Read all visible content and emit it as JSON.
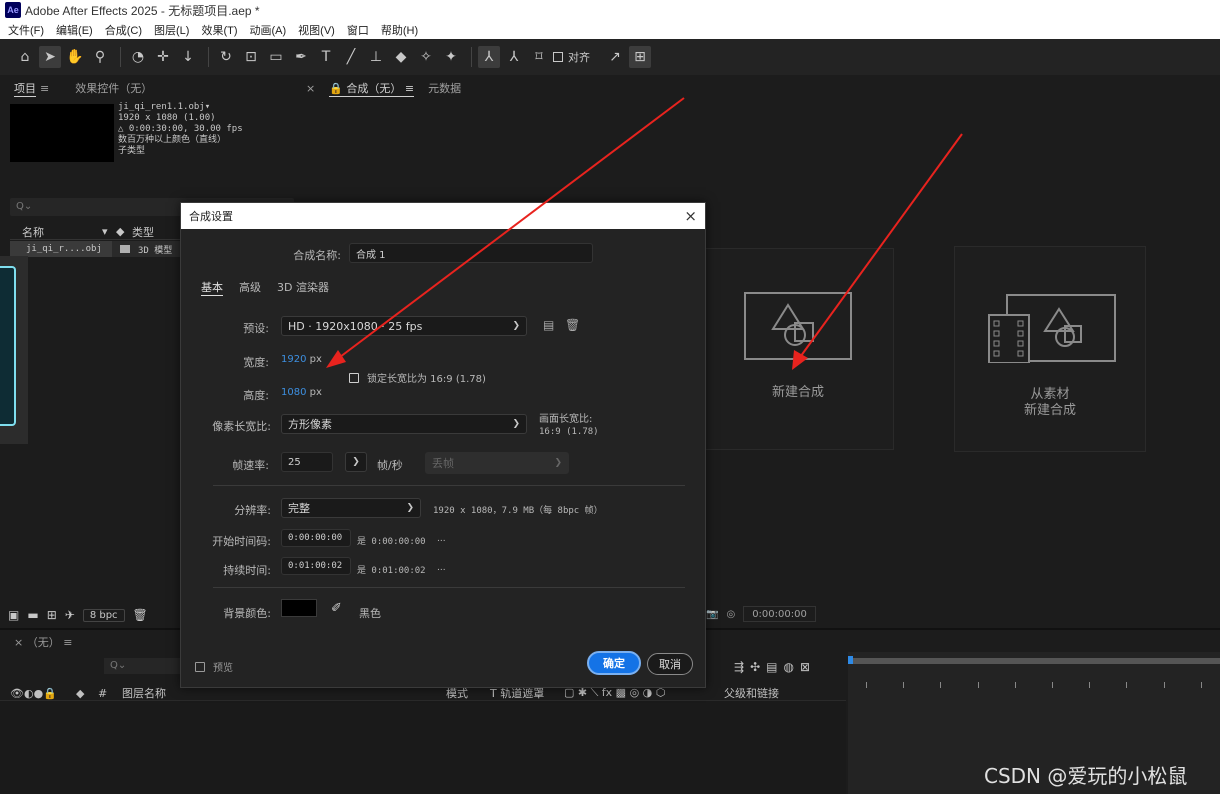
{
  "app": {
    "logo": "Ae",
    "window_title": "Adobe After Effects 2025 - 无标题项目.aep *"
  },
  "menu": [
    "文件(F)",
    "编辑(E)",
    "合成(C)",
    "图层(L)",
    "效果(T)",
    "动画(A)",
    "视图(V)",
    "窗口",
    "帮助(H)"
  ],
  "toolbar": {
    "align_label": "对齐"
  },
  "project_panel": {
    "tab_project": "项目",
    "tab_menu": "≡",
    "tab_effects": "效果控件（无）",
    "file_info": [
      "ji_qi_ren1.1.obj▾",
      "1920 x 1080 (1.00)",
      "△ 0:00:30:00, 30.00 fps",
      "数百万种以上颜色（直线）",
      "子类型"
    ],
    "search_placeholder": "Q⌄",
    "col_name": "名称",
    "col_type": "类型",
    "file_name": "ji_qi_r....obj",
    "file_type": "3D 模型",
    "bpc": "8 bpc"
  },
  "comp_panel": {
    "tab_close": "×",
    "tab_lock": "🔒",
    "tab_comp": "合成（无）",
    "tab_menu": "≡",
    "tab_meta": "元数据",
    "new_comp": "新建合成",
    "from_footage_1": "从素材",
    "from_footage_2": "新建合成",
    "time": "0:00:00:00"
  },
  "timeline": {
    "tab": "×  （无）  ≡",
    "search_placeholder": "Q⌄",
    "col_layer_name": "图层名称",
    "col_mode": "模式",
    "col_track": "T  轨道遮罩",
    "col_parent": "父级和链接",
    "col_hash": "#"
  },
  "dialog": {
    "title": "合成设置",
    "close": "×",
    "name_label": "合成名称:",
    "name_value": "合成 1",
    "tabs": [
      "基本",
      "高级",
      "3D 渲染器"
    ],
    "preset_label": "预设:",
    "preset_value": "HD · 1920x1080 · 25 fps",
    "width_label": "宽度:",
    "width_value": "1920",
    "height_label": "高度:",
    "height_value": "1080",
    "unit_px": "px",
    "lock_ratio": "锁定长宽比为 16:9 (1.78)",
    "pixel_ratio_label": "像素长宽比:",
    "pixel_ratio_value": "方形像素",
    "frame_ratio_label": "画面长宽比:",
    "frame_ratio_value": "16:9 (1.78)",
    "fps_label": "帧速率:",
    "fps_value": "25",
    "fps_unit": "帧/秒",
    "drop_frame": "丢帧",
    "resolution_label": "分辨率:",
    "resolution_value": "完整",
    "resolution_info": "1920 x 1080，7.9 MB（每 8bpc 帧）",
    "start_label": "开始时间码:",
    "start_value": "0:00:00:00",
    "start_is": "是 0:00:00:00",
    "duration_label": "持续时间:",
    "duration_value": "0:01:00:02",
    "duration_is": "是 0:01:00:02",
    "ellipsis": "...",
    "bg_label": "背景颜色:",
    "bg_name": "黑色",
    "preview": "预览",
    "ok": "确定",
    "cancel": "取消"
  },
  "colors": {
    "accent": "#1473e6",
    "link_blue": "#3d8fe0",
    "arrow_red": "#e8231e",
    "bg_color_swatch": "#000000"
  },
  "watermark": "CSDN @爱玩的小松鼠"
}
